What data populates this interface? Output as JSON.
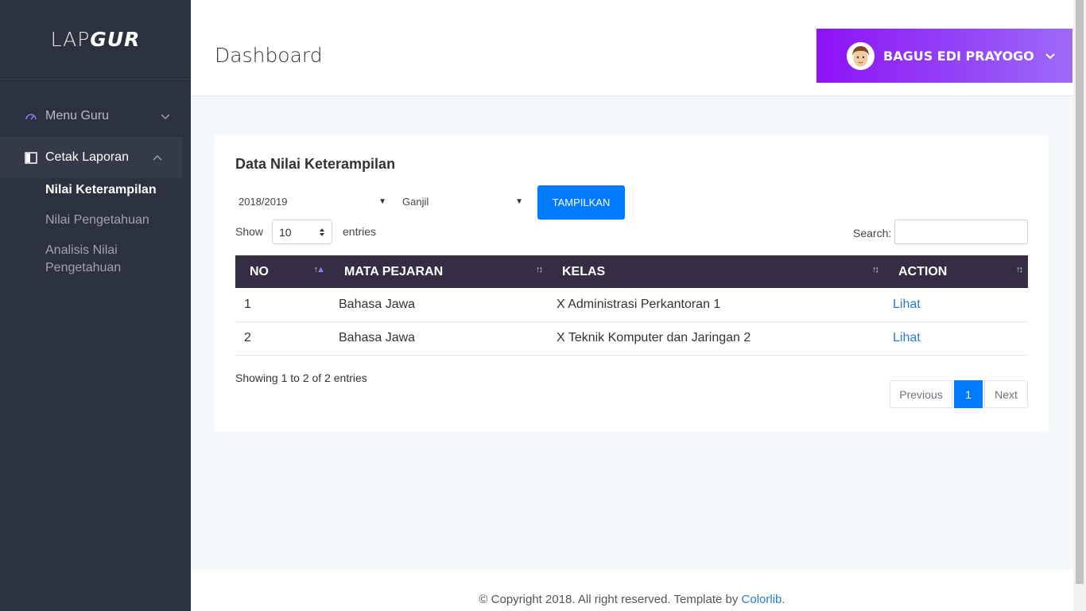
{
  "sidebar": {
    "logo_light": "LAP",
    "logo_bold": "GUR",
    "items": [
      {
        "label": "Menu Guru",
        "icon": "dashboard-gauge-icon",
        "chevron": "chevron-down-icon"
      },
      {
        "label": "Cetak Laporan",
        "icon": "book-icon",
        "chevron": "chevron-up-icon"
      }
    ],
    "submenu": [
      {
        "label": "Nilai Keterampilan"
      },
      {
        "label": "Nilai Pengetahuan"
      },
      {
        "label": "Analisis Nilai Pengetahuan"
      }
    ]
  },
  "header": {
    "title": "Dashboard",
    "user_name": "BAGUS EDI PRAYOGO",
    "colors": {
      "gradient_start": "#8d12f6",
      "gradient_end": "#9d6af8"
    }
  },
  "card": {
    "title": "Data Nilai Keterampilan",
    "year_select": "2018/2019",
    "semester_select": "Ganjil",
    "button_label": "TAMPILKAN",
    "show_label": "Show",
    "entries_value": "10",
    "entries_label": "entries",
    "search_label": "Search:",
    "search_value": ""
  },
  "table": {
    "headers": [
      "NO",
      "MATA PEJARAN",
      "KELAS",
      "ACTION"
    ],
    "rows": [
      {
        "no": "1",
        "mapel": "Bahasa Jawa",
        "kelas": "X Administrasi Perkantoran 1",
        "action": "Lihat"
      },
      {
        "no": "2",
        "mapel": "Bahasa Jawa",
        "kelas": "X Teknik Komputer dan Jaringan 2",
        "action": "Lihat"
      }
    ]
  },
  "info": "Showing 1 to 2 of 2 entries",
  "pagination": {
    "previous": "Previous",
    "current": "1",
    "next": "Next"
  },
  "footer": {
    "text": "© Copyright 2018. All right reserved. Template by ",
    "link": "Colorlib",
    "suffix": "."
  },
  "colors": {
    "sidebar": "#2c313f",
    "accent": "#007bff",
    "table_header": "#342d43"
  }
}
